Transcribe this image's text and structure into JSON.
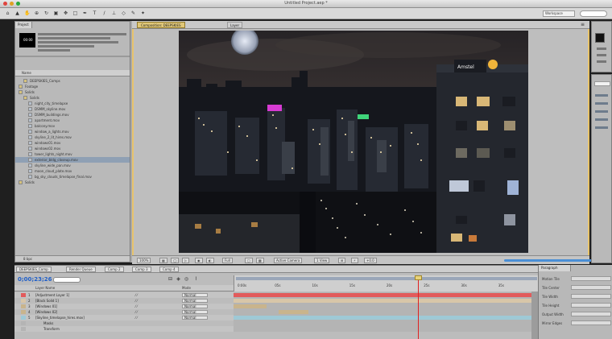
{
  "window": {
    "title": "Untitled Project.aep *",
    "workspace_label": "Workspace"
  },
  "project_panel": {
    "tab_label": "Project",
    "thumb_label": "00:00",
    "list_header": "Name",
    "items": [
      {
        "name": "DEEPSKIES_Comps",
        "indent": 1,
        "folder": true
      },
      {
        "name": "Footage",
        "indent": 0,
        "folder": true
      },
      {
        "name": "Solids",
        "indent": 0,
        "folder": true
      },
      {
        "name": "Solids",
        "indent": 1,
        "folder": true
      },
      {
        "name": "night_city_timelapse",
        "indent": 2,
        "folder": false
      },
      {
        "name": "DSMM_skyline.mov",
        "indent": 2,
        "folder": false
      },
      {
        "name": "DSMM_buildings.mov",
        "indent": 2,
        "folder": false
      },
      {
        "name": "apartment.mov",
        "indent": 2,
        "folder": false
      },
      {
        "name": "balcony.mov",
        "indent": 2,
        "folder": false
      },
      {
        "name": "window_a_lights.mov",
        "indent": 2,
        "folder": false
      },
      {
        "name": "skyline_2_lit_hires.mov",
        "indent": 2,
        "folder": false
      },
      {
        "name": "windows01.mov",
        "indent": 2,
        "folder": false
      },
      {
        "name": "windows02.mov",
        "indent": 2,
        "folder": false
      },
      {
        "name": "tower_lights_night.mov",
        "indent": 2,
        "folder": false
      },
      {
        "name": "exterior_bldg_closeup.mov",
        "indent": 2,
        "folder": false
      },
      {
        "name": "skyline_wide_pan.mov",
        "indent": 2,
        "folder": false
      },
      {
        "name": "moon_cloud_plate.mov",
        "indent": 2,
        "folder": false
      },
      {
        "name": "bg_sky_clouds_timelapse_final.mov",
        "indent": 2,
        "folder": false
      },
      {
        "name": "Solids",
        "indent": 0,
        "folder": true
      }
    ],
    "bpc_label": "8 bpc"
  },
  "comp_viewer": {
    "tab_label": "Composition: DEEPSKIES",
    "layer_tab": "Layer",
    "sign_text": "Amstel",
    "controls": [
      "100%",
      "Full",
      "Active Camera",
      "1 View",
      "+0.0"
    ]
  },
  "timeline": {
    "tabs": [
      "DEEPSKIES_Comp",
      "Render Queue",
      "Comp 2",
      "Comp 3",
      "Comp 4"
    ],
    "timecode": "0;00;23;26",
    "layer_header": "Layer Name",
    "mode_header": "Mode",
    "layers": [
      {
        "num": "1",
        "name": "[Adjustment Layer 1]",
        "mode": "Normal",
        "color": "#e25b5b",
        "bar_start": 0.0,
        "bar_end": 1.0
      },
      {
        "num": "2",
        "name": "[Black Solid 1]",
        "mode": "Normal",
        "color": "#d8c6a8",
        "bar_start": 0.0,
        "bar_end": 1.0
      },
      {
        "num": "3",
        "name": "[Windows 01]",
        "mode": "Normal",
        "color": "#c9b48c",
        "bar_start": 0.0,
        "bar_end": 0.11
      },
      {
        "num": "4",
        "name": "[Windows 02]",
        "mode": "Normal",
        "color": "#c9b48c",
        "bar_start": 0.15,
        "bar_end": 0.25
      },
      {
        "num": "5",
        "name": "[Skyline_timelapse_hires.mov]",
        "mode": "Normal",
        "color": "#9ec9d6",
        "bar_start": 0.0,
        "bar_end": 1.0
      },
      {
        "num": "",
        "name": "Masks",
        "mode": "",
        "color": "#b4b4b4",
        "bar_start": 0,
        "bar_end": 0
      },
      {
        "num": "",
        "name": "Transform",
        "mode": "",
        "color": "#b4b4b4",
        "bar_start": 0,
        "bar_end": 0
      }
    ],
    "ruler_ticks": [
      "0:00s",
      "05s",
      "10s",
      "15s",
      "20s",
      "25s",
      "30s",
      "35s"
    ],
    "playhead_fraction": 0.62
  },
  "properties_panel": {
    "tab_label": "Paragraph",
    "rows": [
      "Motion Tile",
      "Tile Center",
      "Tile Width",
      "Tile Height",
      "Output Width",
      "Mirror Edges"
    ]
  }
}
